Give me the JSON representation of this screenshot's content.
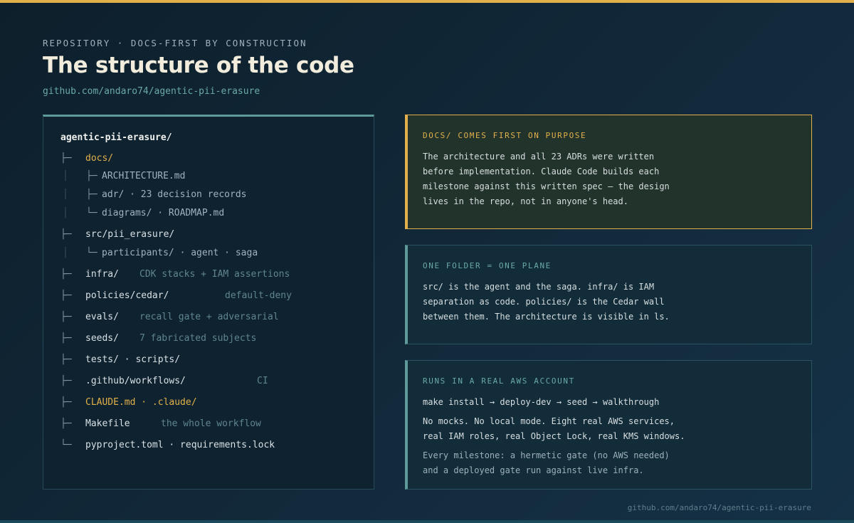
{
  "header": {
    "kicker": "REPOSITORY · DOCS-FIRST BY CONSTRUCTION",
    "title": "The structure of the code",
    "subtitle": "github.com/andaro74/agentic-pii-erasure"
  },
  "tree": {
    "root": "agentic-pii-erasure/",
    "branch_glyph": "├─",
    "last_glyph": "└─",
    "sub_branch": "├─",
    "sub_last": "└─",
    "pipe": "│",
    "docs": "docs/",
    "docs_children": [
      "ARCHITECTURE.md",
      "adr/ · 23 decision records",
      "diagrams/ · ROADMAP.md"
    ],
    "src": "src/pii_erasure/",
    "src_children": [
      "participants/ · agent · saga"
    ],
    "infra": "infra/",
    "infra_comment": "CDK stacks + IAM assertions",
    "policies": "policies/cedar/",
    "policies_comment": "default-deny",
    "evals": "evals/",
    "evals_comment": "recall gate + adversarial",
    "seeds": "seeds/",
    "seeds_comment": "7 fabricated subjects",
    "tests": "tests/ · scripts/",
    "github": ".github/workflows/",
    "github_comment": "CI",
    "claude": "CLAUDE.md · .claude/",
    "makefile": "Makefile",
    "makefile_comment": "the whole workflow",
    "pyproject": "pyproject.toml · requirements.lock"
  },
  "cards": [
    {
      "heading": "DOCS/ COMES FIRST ON PURPOSE",
      "lines": [
        "The architecture and all 23 ADRs were written",
        "before implementation. Claude Code builds each",
        "milestone against this written spec — the design",
        "lives in the repo, not in anyone's head."
      ]
    },
    {
      "heading": "ONE FOLDER = ONE PLANE",
      "lines": [
        "src/ is the agent and the saga. infra/ is IAM",
        "separation as code. policies/ is the Cedar wall",
        "between them. The architecture is visible in ls."
      ]
    },
    {
      "heading": "RUNS IN A REAL AWS ACCOUNT",
      "command": "make install → deploy-dev → seed → walkthrough",
      "lines": [
        "No mocks. No local mode. Eight real AWS services,",
        "real IAM roles, real Object Lock, real KMS windows."
      ],
      "dim_lines": [
        "Every milestone: a hermetic gate (no AWS needed)",
        "and a deployed gate run against live infra."
      ]
    }
  ],
  "footer": "github.com/andaro74/agentic-pii-erasure",
  "colors": {
    "accent": "#e2b04a",
    "teal": "#5e9a99",
    "background": "#0d1f2b"
  }
}
